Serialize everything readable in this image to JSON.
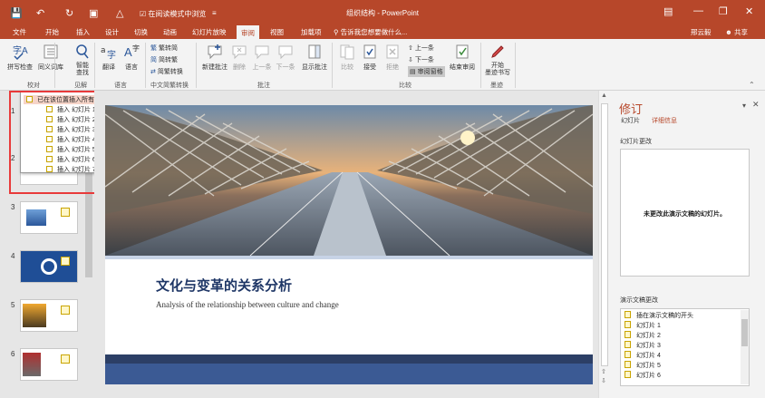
{
  "app": {
    "title": "组织结构 - PowerPoint",
    "quick_access_label": "在阅读模式中浏览",
    "login": "邢云毅",
    "share": "共享"
  },
  "tabs": [
    "文件",
    "开始",
    "插入",
    "设计",
    "切换",
    "动画",
    "幻灯片放映",
    "审阅",
    "视图",
    "加载项"
  ],
  "active_tab": "审阅",
  "tell_me": "告诉我您想要做什么...",
  "ribbon": {
    "spell": "拼写检查",
    "thesaurus": "同义词库",
    "smart_lookup": "智能\n查找",
    "translate": "翻译",
    "language": "语言",
    "to_trad": "繁转简",
    "to_simp": "简转繁",
    "convert": "简繁转换",
    "new_comment": "新建批注",
    "delete": "删除",
    "prev": "上一条",
    "next": "下一条",
    "show_comments": "显示批注",
    "compare": "比较",
    "accept": "接受",
    "reject": "拒绝",
    "prev2": "上一条",
    "next2": "下一条",
    "pane": "审阅窗格",
    "end_review": "结束审阅",
    "start_ink": "开始\n墨迹书写",
    "groups": {
      "proofing": "校对",
      "insights": "见解",
      "language": "语言",
      "chinese": "中文简繁转换",
      "comments": "批注",
      "compare": "比较",
      "ink": "墨迹"
    }
  },
  "thumbs": [
    "1",
    "2",
    "3",
    "4",
    "5",
    "6"
  ],
  "popup": {
    "header": "已在该位置插入所有幻灯片",
    "items": [
      "插入 幻灯片 1 (123)",
      "插入 幻灯片 2 (123)",
      "插入 幻灯片 3 (123)",
      "插入 幻灯片 4 (123)",
      "插入 幻灯片 5 (123)",
      "插入 幻灯片 6 (123)",
      "插入 幻灯片 7 (123)"
    ]
  },
  "slide": {
    "title": "文化与变革的关系分析",
    "subtitle": "Analysis of the relationship between culture and change"
  },
  "revisions": {
    "title": "修订",
    "tab_slides": "幻灯片",
    "tab_details": "详细信息",
    "slide_changes": "幻灯片更改",
    "no_changes": "未更改此演示文稿的幻灯片。",
    "doc_changes": "演示文稿更改",
    "list": [
      "插在演示文稿的开头",
      "幻灯片 1",
      "幻灯片 2",
      "幻灯片 3",
      "幻灯片 4",
      "幻灯片 5",
      "幻灯片 6"
    ]
  }
}
